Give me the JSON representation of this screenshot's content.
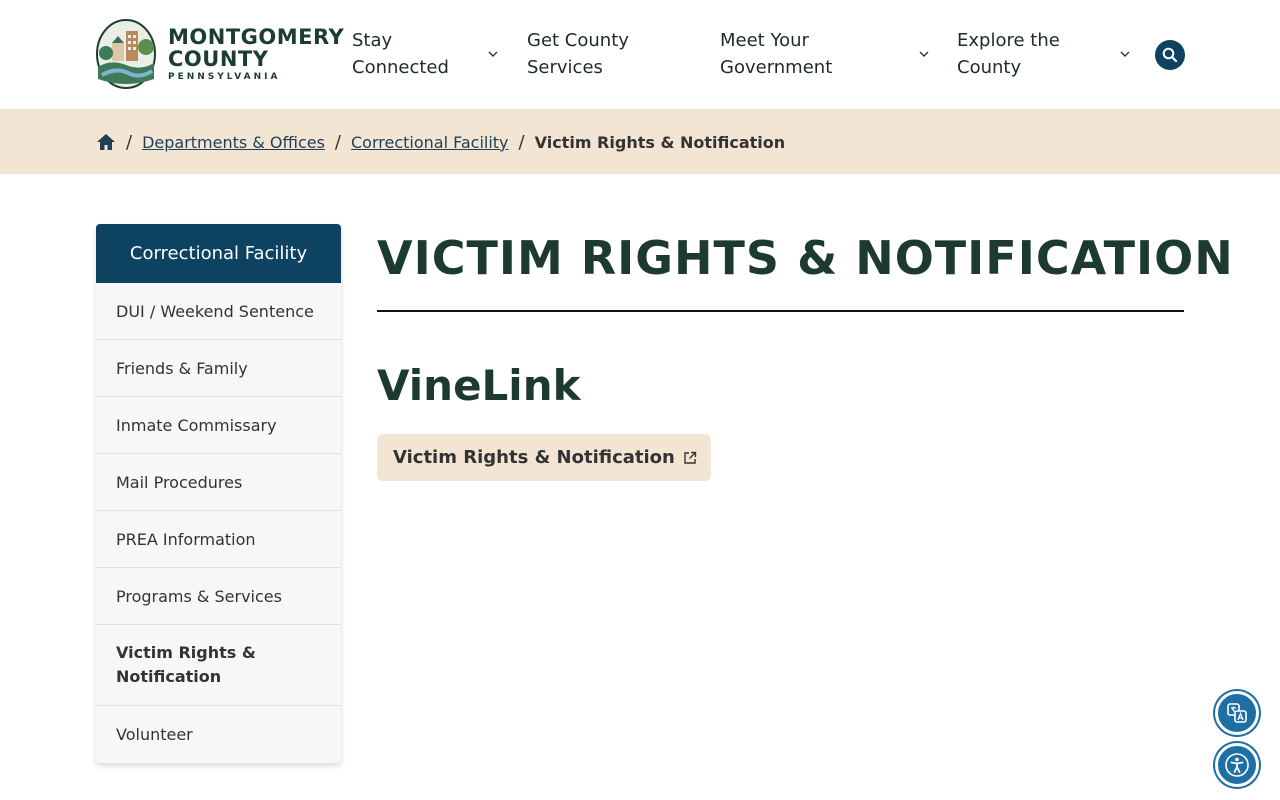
{
  "header": {
    "logo": {
      "line1": "MONTGOMERY",
      "line2": "COUNTY",
      "line3": "PENNSYLVANIA"
    },
    "nav": [
      {
        "label_line1": "Stay",
        "label_line2": "Connected"
      },
      {
        "label_line1": "Get County",
        "label_line2": "Services"
      },
      {
        "label_line1": "Meet Your",
        "label_line2": "Government"
      },
      {
        "label_line1": "Explore the",
        "label_line2": "County"
      }
    ]
  },
  "breadcrumb": {
    "items": [
      "Departments & Offices",
      "Correctional Facility"
    ],
    "current": "Victim Rights & Notification",
    "separator": "/"
  },
  "sidebar": {
    "heading": "Correctional Facility",
    "items": [
      {
        "label": "DUI / Weekend Sentence"
      },
      {
        "label": "Friends & Family"
      },
      {
        "label": "Inmate Commissary"
      },
      {
        "label": "Mail Procedures"
      },
      {
        "label": "PREA Information"
      },
      {
        "label": "Programs & Services"
      },
      {
        "label": "Victim Rights & Notification",
        "active": true
      },
      {
        "label": "Volunteer"
      }
    ]
  },
  "main": {
    "title": "VICTIM RIGHTS & NOTIFICATION",
    "section_title": "VineLink",
    "link_label": "Victim Rights & Notification"
  },
  "colors": {
    "brand_navy": "#0d4360",
    "brand_green": "#1c3a2f",
    "tan": "#f3e5d4"
  }
}
